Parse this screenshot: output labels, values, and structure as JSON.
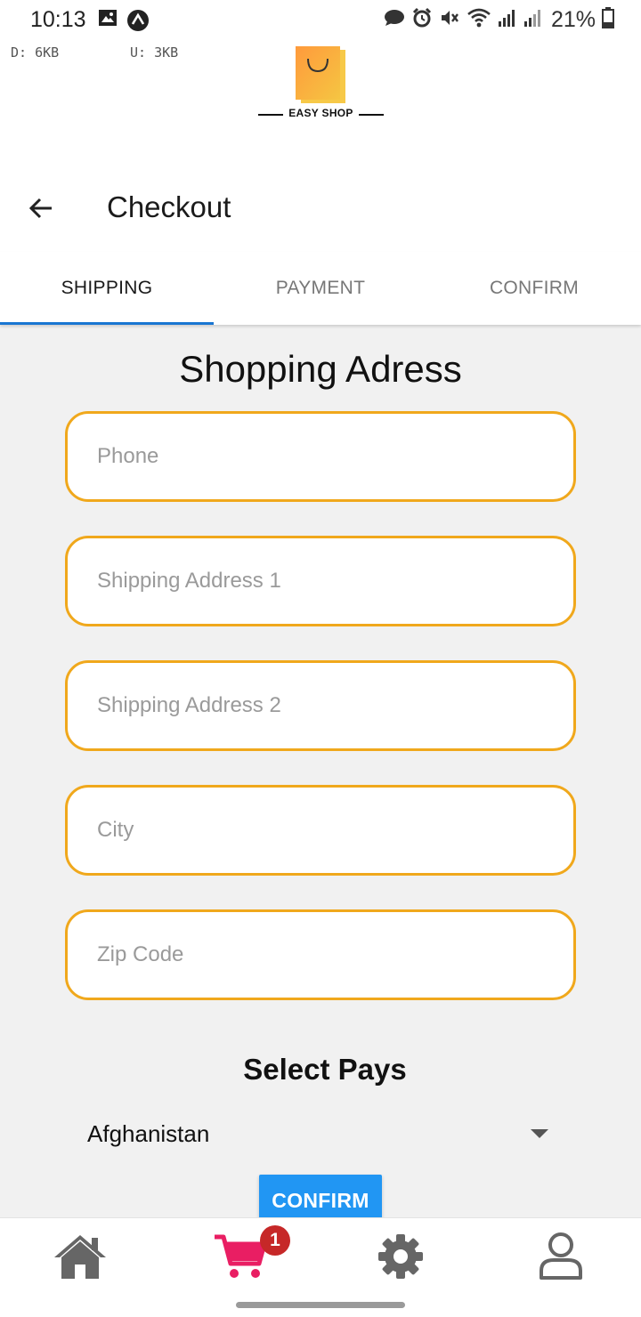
{
  "status_bar": {
    "time": "10:13",
    "battery": "21%",
    "download_speed": "D: 6KB",
    "upload_speed": "U: 3KB"
  },
  "logo": {
    "text": "EASY SHOP"
  },
  "app_bar": {
    "title": "Checkout"
  },
  "tabs": [
    {
      "label": "SHIPPING",
      "active": true
    },
    {
      "label": "PAYMENT",
      "active": false
    },
    {
      "label": "CONFIRM",
      "active": false
    }
  ],
  "form": {
    "title": "Shopping Adress",
    "fields": {
      "phone": {
        "placeholder": "Phone",
        "value": ""
      },
      "address1": {
        "placeholder": "Shipping Address 1",
        "value": ""
      },
      "address2": {
        "placeholder": "Shipping Address 2",
        "value": ""
      },
      "city": {
        "placeholder": "City",
        "value": ""
      },
      "zip": {
        "placeholder": "Zip Code",
        "value": ""
      }
    },
    "country_label": "Select Pays",
    "country_selected": "Afghanistan",
    "confirm_label": "CONFIRM"
  },
  "bottom_nav": {
    "items": [
      "home-icon",
      "cart-icon",
      "settings-icon",
      "user-icon"
    ],
    "cart_badge": "1"
  },
  "colors": {
    "field_border": "#f0a81c",
    "tab_indicator": "#1976d2",
    "confirm_button": "#2196f3",
    "cart_active": "#e91e63",
    "badge": "#c62828",
    "nav_inactive": "#666666"
  }
}
